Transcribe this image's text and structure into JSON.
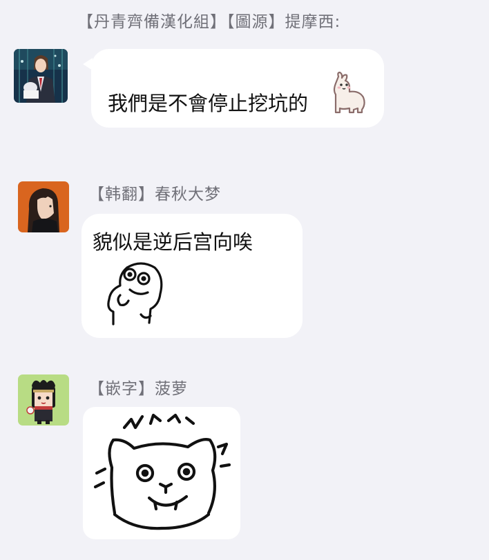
{
  "messages": [
    {
      "sender": "【丹青齊備漢化組】【圖源】提摩西:",
      "text": "我們是不會停止挖坑的",
      "sticker": "alpaca-emoji",
      "avatar": "avatar-anime-man-suit"
    },
    {
      "sender": "【韩翻】春秋大梦",
      "text": "貌似是逆后宫向唉",
      "sticker": "doodle-creature-sticker",
      "avatar": "avatar-anime-long-hair-orange"
    },
    {
      "sender": "【嵌字】菠萝",
      "text": "",
      "sticker": "shocked-cat-sticker",
      "avatar": "avatar-chibi-girl-green"
    }
  ],
  "colors": {
    "background": "#f2f2f7",
    "bubble": "#ffffff",
    "sender_name": "#707078",
    "message_text": "#111111"
  }
}
